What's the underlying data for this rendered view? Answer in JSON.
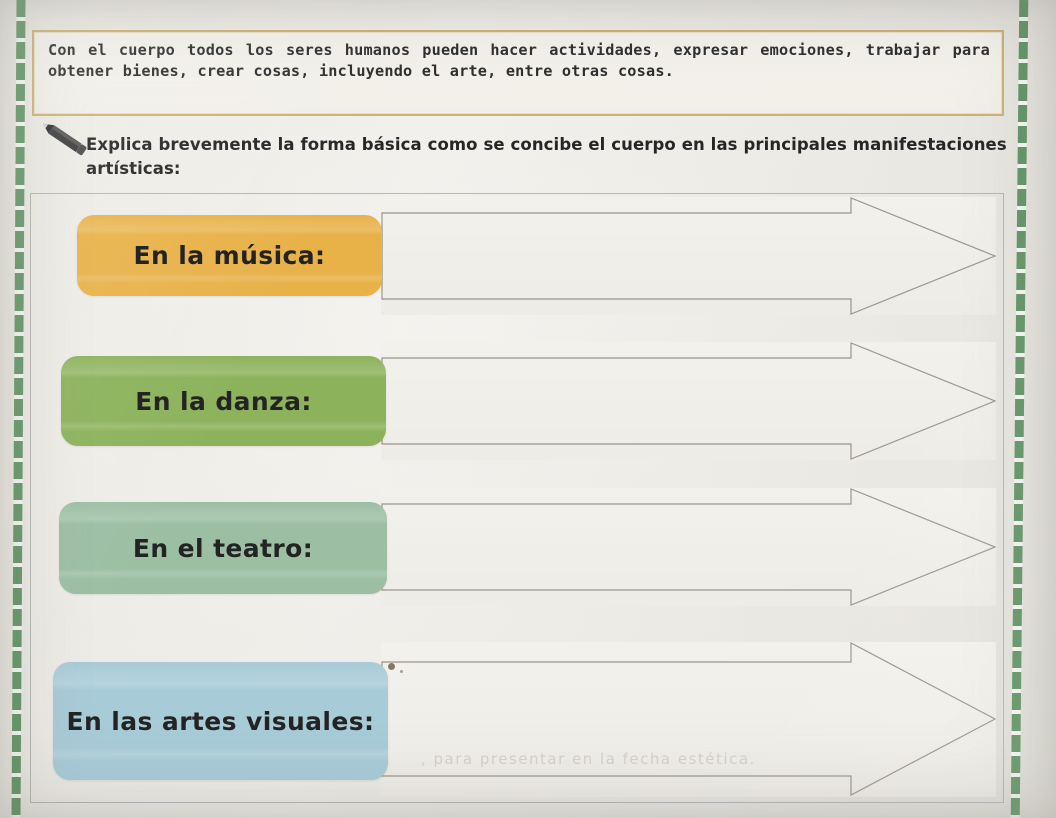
{
  "info_box": {
    "text": "Con el cuerpo todos los seres humanos pueden hacer actividades, expresar emociones, trabajar para obtener bienes, crear cosas, incluyendo el arte, entre otras cosas."
  },
  "instruction": {
    "icon": "pencil-icon",
    "text": "Explica brevemente la  forma básica como se concibe el cuerpo en las principales manifestaciones artísticas:"
  },
  "rows": [
    {
      "label": "En la música:",
      "color": "#e8b249",
      "answer_value": "",
      "answer_placeholder": ""
    },
    {
      "label": "En la danza:",
      "color": "#8cb35c",
      "answer_value": "",
      "answer_placeholder": ""
    },
    {
      "label": "En el teatro:",
      "color": "#9cbfa4",
      "answer_value": "",
      "answer_placeholder": ""
    },
    {
      "label": "En las artes visuales:",
      "color": "#a8cbd8",
      "answer_value": "",
      "answer_placeholder": ""
    }
  ],
  "decor": {
    "edge_stripe_color": "#4f8b55",
    "info_border_color": "#cfb273",
    "frame_border_color": "#b6b6b6",
    "arrow_outline_color": "#9a958c",
    "ghost_text_row0": "",
    "ghost_text_row3": ", para presentar en la fecha estética."
  }
}
